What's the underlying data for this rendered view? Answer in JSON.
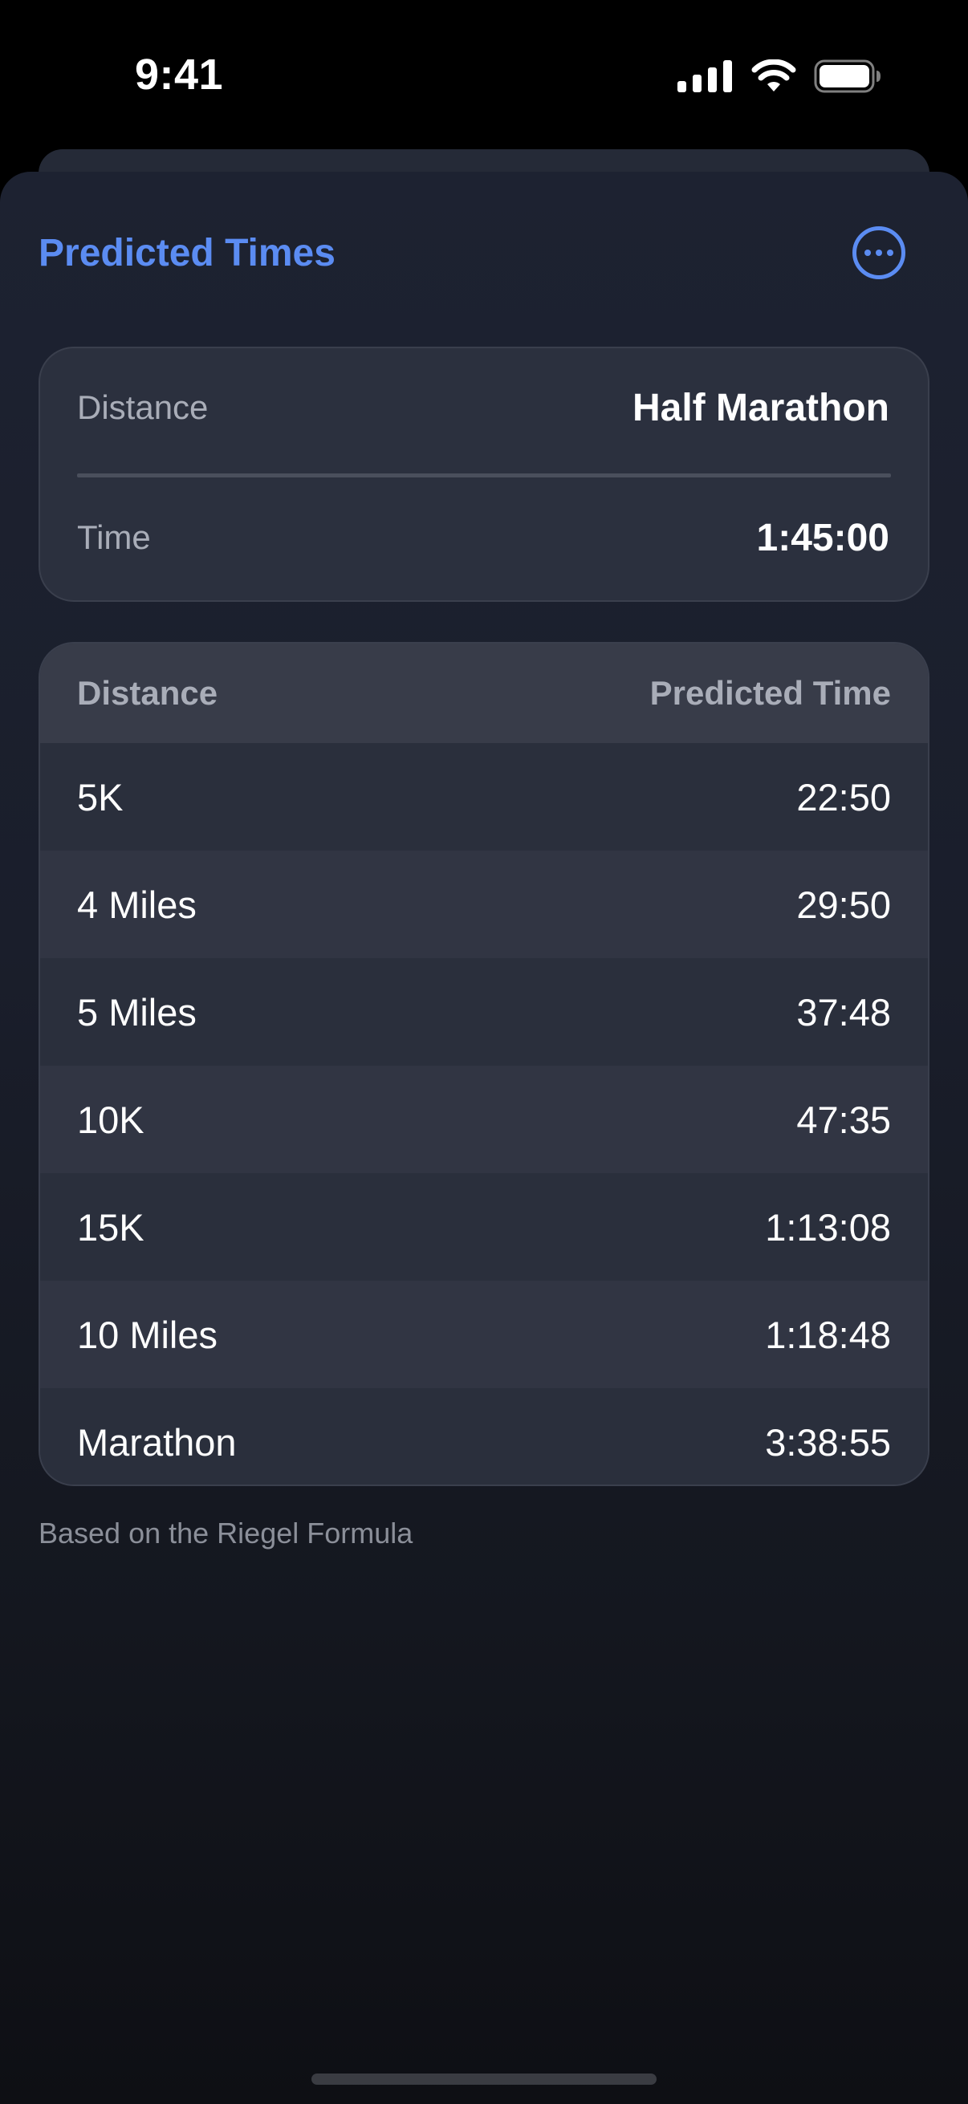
{
  "status_bar": {
    "time": "9:41"
  },
  "header": {
    "title": "Predicted Times",
    "more_icon": "ellipsis-circle-icon",
    "accent_color": "#5b8cf2"
  },
  "input": {
    "distance_label": "Distance",
    "distance_value": "Half Marathon",
    "time_label": "Time",
    "time_value": "1:45:00"
  },
  "table": {
    "headers": [
      "Distance",
      "Predicted Time"
    ],
    "rows": [
      {
        "distance": "5K",
        "time": "22:50"
      },
      {
        "distance": "4 Miles",
        "time": "29:50"
      },
      {
        "distance": "5 Miles",
        "time": "37:48"
      },
      {
        "distance": "10K",
        "time": "47:35"
      },
      {
        "distance": "15K",
        "time": "1:13:08"
      },
      {
        "distance": "10 Miles",
        "time": "1:18:48"
      },
      {
        "distance": "Marathon",
        "time": "3:38:55"
      }
    ]
  },
  "footnote": "Based on the Riegel Formula"
}
